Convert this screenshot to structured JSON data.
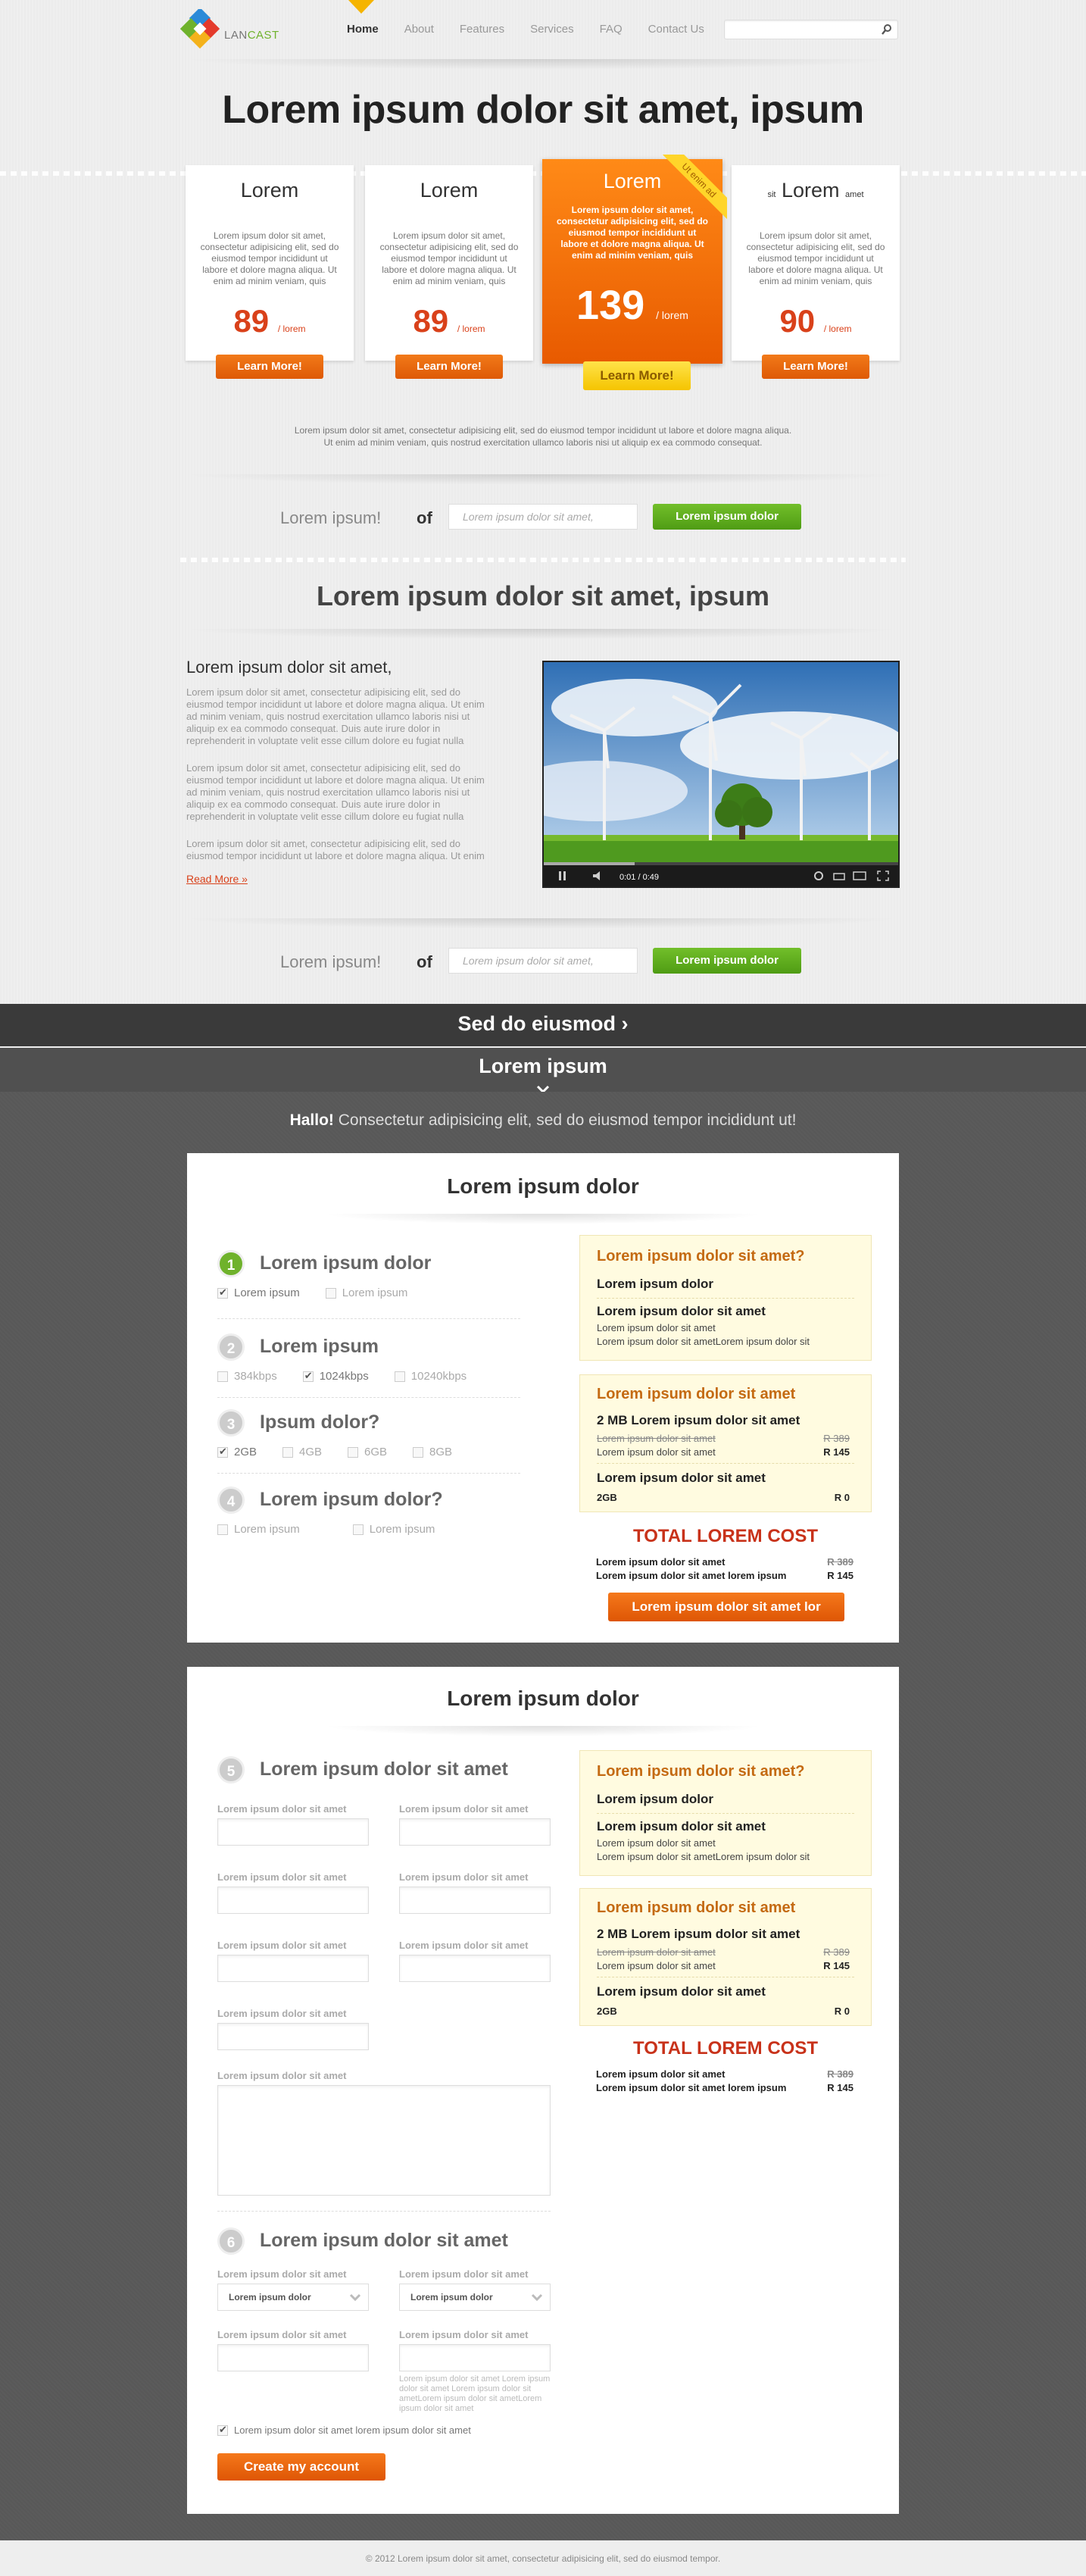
{
  "header": {
    "logo_text_a": "LAN",
    "logo_text_b": "CAST",
    "nav": [
      "Home",
      "About",
      "Features",
      "Services",
      "FAQ",
      "Contact Us"
    ],
    "search_placeholder": ""
  },
  "hero": {
    "title": "Lorem ipsum dolor sit amet, ipsum"
  },
  "plans": [
    {
      "title": "Lorem",
      "title_small": "",
      "desc": "Lorem ipsum dolor sit amet, consectetur adipisicing elit, sed do eiusmod tempor incididunt ut labore et dolore magna aliqua. Ut enim ad minim veniam, quis",
      "price": "89",
      "unit": "/ lorem",
      "button": "Learn More!"
    },
    {
      "title": "Lorem",
      "title_small": "",
      "desc": "Lorem ipsum dolor sit amet, consectetur adipisicing elit, sed do eiusmod tempor incididunt ut labore et dolore magna aliqua. Ut enim ad minim veniam, quis",
      "price": "89",
      "unit": "/ lorem",
      "button": "Learn More!"
    },
    {
      "title": "Lorem",
      "ribbon": "Ut enim ad",
      "desc": "Lorem ipsum dolor sit amet, consectetur adipisicing elit, sed do eiusmod tempor incididunt ut labore et dolore magna aliqua. Ut enim ad minim veniam, quis",
      "price": "139",
      "unit": "/ lorem",
      "button": "Learn More!"
    },
    {
      "title": "Lorem",
      "title_pre": "sit",
      "title_post": "amet",
      "desc": "Lorem ipsum dolor sit amet, consectetur adipisicing elit, sed do eiusmod tempor incididunt ut labore et dolore magna aliqua. Ut enim ad minim veniam, quis",
      "price": "90",
      "unit": "/ lorem",
      "button": "Learn More!"
    }
  ],
  "note": {
    "line1": "Lorem ipsum dolor sit amet, consectetur adipisicing elit, sed do eiusmod tempor incididunt ut labore et dolore magna aliqua.",
    "line2": "Ut enim ad minim veniam, quis nostrud exercitation ullamco laboris nisi ut aliquip ex ea commodo consequat."
  },
  "signup": {
    "label": "Lorem ipsum!",
    "of": "of",
    "placeholder": "Lorem ipsum dolor sit amet,",
    "button": "Lorem ipsum dolor"
  },
  "section2": {
    "title": "Lorem ipsum dolor sit amet, ipsum",
    "about_title": "Lorem ipsum dolor sit amet,",
    "paragraphs": [
      "Lorem ipsum dolor sit amet, consectetur adipisicing elit, sed do eiusmod tempor incididunt ut labore et dolore magna aliqua. Ut enim ad minim veniam, quis nostrud exercitation ullamco laboris nisi ut aliquip ex ea commodo consequat. Duis aute irure dolor in reprehenderit in voluptate velit esse cillum dolore eu fugiat nulla",
      "Lorem ipsum dolor sit amet, consectetur adipisicing elit, sed do eiusmod tempor incididunt ut labore et dolore magna aliqua. Ut enim ad minim veniam, quis nostrud exercitation ullamco laboris nisi ut aliquip ex ea commodo consequat. Duis aute irure dolor in reprehenderit in voluptate velit esse cillum dolore eu fugiat nulla",
      "Lorem ipsum dolor sit amet, consectetur adipisicing elit, sed do eiusmod tempor incididunt ut labore et dolore magna aliqua. Ut enim"
    ],
    "read_more": "Read More »",
    "video_time": "0:01 / 0:49"
  },
  "bands": {
    "band1": "Sed do eiusmod",
    "band2": "Lorem ipsum"
  },
  "hallo": {
    "bold": "Hallo!",
    "text": " Consectetur adipisicing elit, sed do eiusmod tempor incididunt ut!"
  },
  "card1": {
    "title": "Lorem ipsum dolor",
    "steps": [
      {
        "num": "1",
        "title": "Lorem ipsum dolor",
        "options": [
          {
            "label": "Lorem ipsum",
            "checked": true
          },
          {
            "label": "Lorem ipsum",
            "checked": false
          }
        ]
      },
      {
        "num": "2",
        "title": "Lorem ipsum",
        "options": [
          {
            "label": "384kbps",
            "checked": false
          },
          {
            "label": "1024kbps",
            "checked": true
          },
          {
            "label": "10240kbps",
            "checked": false
          }
        ]
      },
      {
        "num": "3",
        "title": "Ipsum dolor?",
        "options": [
          {
            "label": "2GB",
            "checked": true
          },
          {
            "label": "4GB",
            "checked": false
          },
          {
            "label": "6GB",
            "checked": false
          },
          {
            "label": "8GB",
            "checked": false
          }
        ]
      },
      {
        "num": "4",
        "title": "Lorem ipsum dolor?",
        "options": [
          {
            "label": "Lorem ipsum",
            "checked": false
          },
          {
            "label": "Lorem ipsum",
            "checked": false
          }
        ]
      }
    ],
    "button": "Lorem ipsum dolor sit amet lor"
  },
  "summary": {
    "box1_title": "Lorem ipsum dolor sit amet?",
    "box1_line1": "Lorem ipsum dolor",
    "box1_line2": "Lorem ipsum dolor sit amet",
    "box1_sub1": "Lorem ipsum dolor sit amet",
    "box1_sub2": "Lorem ipsum dolor sit ametLorem ipsum dolor sit",
    "box2_title": "Lorem ipsum dolor sit amet",
    "box2_line1": "2 MB Lorem ipsum dolor sit amet",
    "box2_r1": "Lorem ipsum dolor sit amet",
    "box2_r1v": "R 389",
    "box2_r2": "Lorem ipsum dolor sit amet",
    "box2_r2v": "R 145",
    "box2_line2": "Lorem ipsum dolor sit amet",
    "box2_r3": "2GB",
    "box2_r3v": "R 0",
    "total_title": "TOTAL LOREM COST",
    "t1": "Lorem ipsum dolor sit amet",
    "t1v": "R 389",
    "t2": "Lorem ipsum dolor sit amet lorem ipsum",
    "t2v": "R 145"
  },
  "card2": {
    "title": "Lorem ipsum dolor",
    "step5": {
      "num": "5",
      "title": "Lorem ipsum dolor sit amet"
    },
    "field_label": "Lorem ipsum dolor sit amet",
    "step6": {
      "num": "6",
      "title": "Lorem ipsum dolor sit amet"
    },
    "select_value": "Lorem ipsum dolor",
    "hint": "Lorem ipsum dolor sit amet Lorem ipsum dolor sit amet Lorem ipsum dolor sit ametLorem ipsum dolor sit ametLorem ipsum dolor sit amet",
    "agree": "Lorem ipsum dolor sit amet lorem ipsum dolor sit amet",
    "button": "Create my account"
  },
  "footer": {
    "text": "© 2012 Lorem ipsum dolor sit amet, consectetur adipisicing elit, sed do eiusmod tempor."
  },
  "colors": {
    "accent_orange": "#e8650a",
    "accent_green": "#5aab1a",
    "price_red": "#d9411a",
    "total_red": "#c8321a",
    "dark_band": "#3a3a3a"
  }
}
